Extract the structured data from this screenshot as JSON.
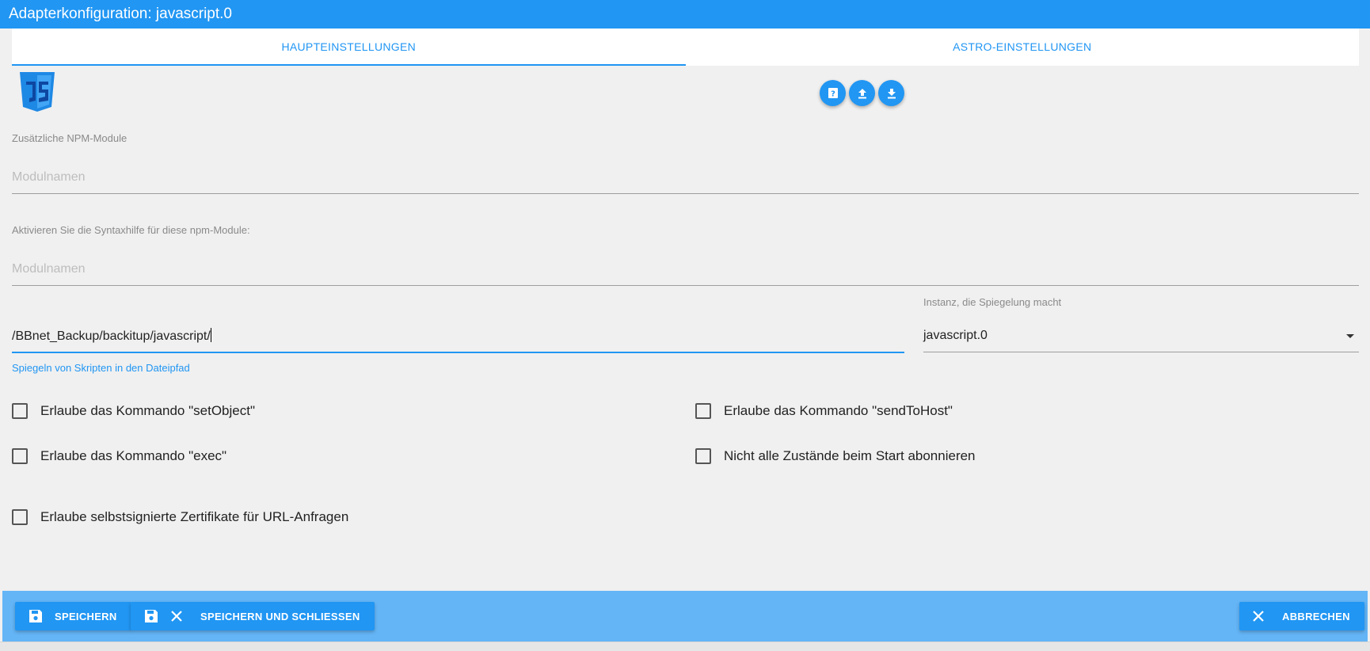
{
  "window": {
    "title": "Adapterkonfiguration: javascript.0"
  },
  "tabs": [
    {
      "label": "HAUPTEINSTELLUNGEN",
      "active": true
    },
    {
      "label": "ASTRO-EINSTELLUNGEN",
      "active": false
    }
  ],
  "npm_modules": {
    "label": "Zusätzliche NPM-Module",
    "placeholder": "Modulnamen"
  },
  "syntax_help": {
    "label": "Aktivieren Sie die Syntaxhilfe für diese npm-Module:",
    "placeholder": "Modulnamen"
  },
  "mirror_path": {
    "value": "/BBnet_Backup/backitup/javascript/",
    "helper": "Spiegeln von Skripten in den Dateipfad"
  },
  "mirror_instance": {
    "label": "Instanz, die Spiegelung macht",
    "value": "javascript.0"
  },
  "checkboxes": {
    "set_object": "Erlaube das Kommando \"setObject\"",
    "send_to_host": "Erlaube das Kommando \"sendToHost\"",
    "exec": "Erlaube das Kommando \"exec\"",
    "no_subscribe": "Nicht alle Zustände beim Start abonnieren",
    "self_signed": "Erlaube selbstsignierte Zertifikate für URL-Anfragen"
  },
  "footer": {
    "save": "SPEICHERN",
    "save_close": "SPEICHERN UND SCHLIESSEN",
    "cancel": "ABBRECHEN"
  },
  "colors": {
    "accent": "#2196f3",
    "footer": "#64b5f6",
    "logo": "#1e88e5"
  }
}
